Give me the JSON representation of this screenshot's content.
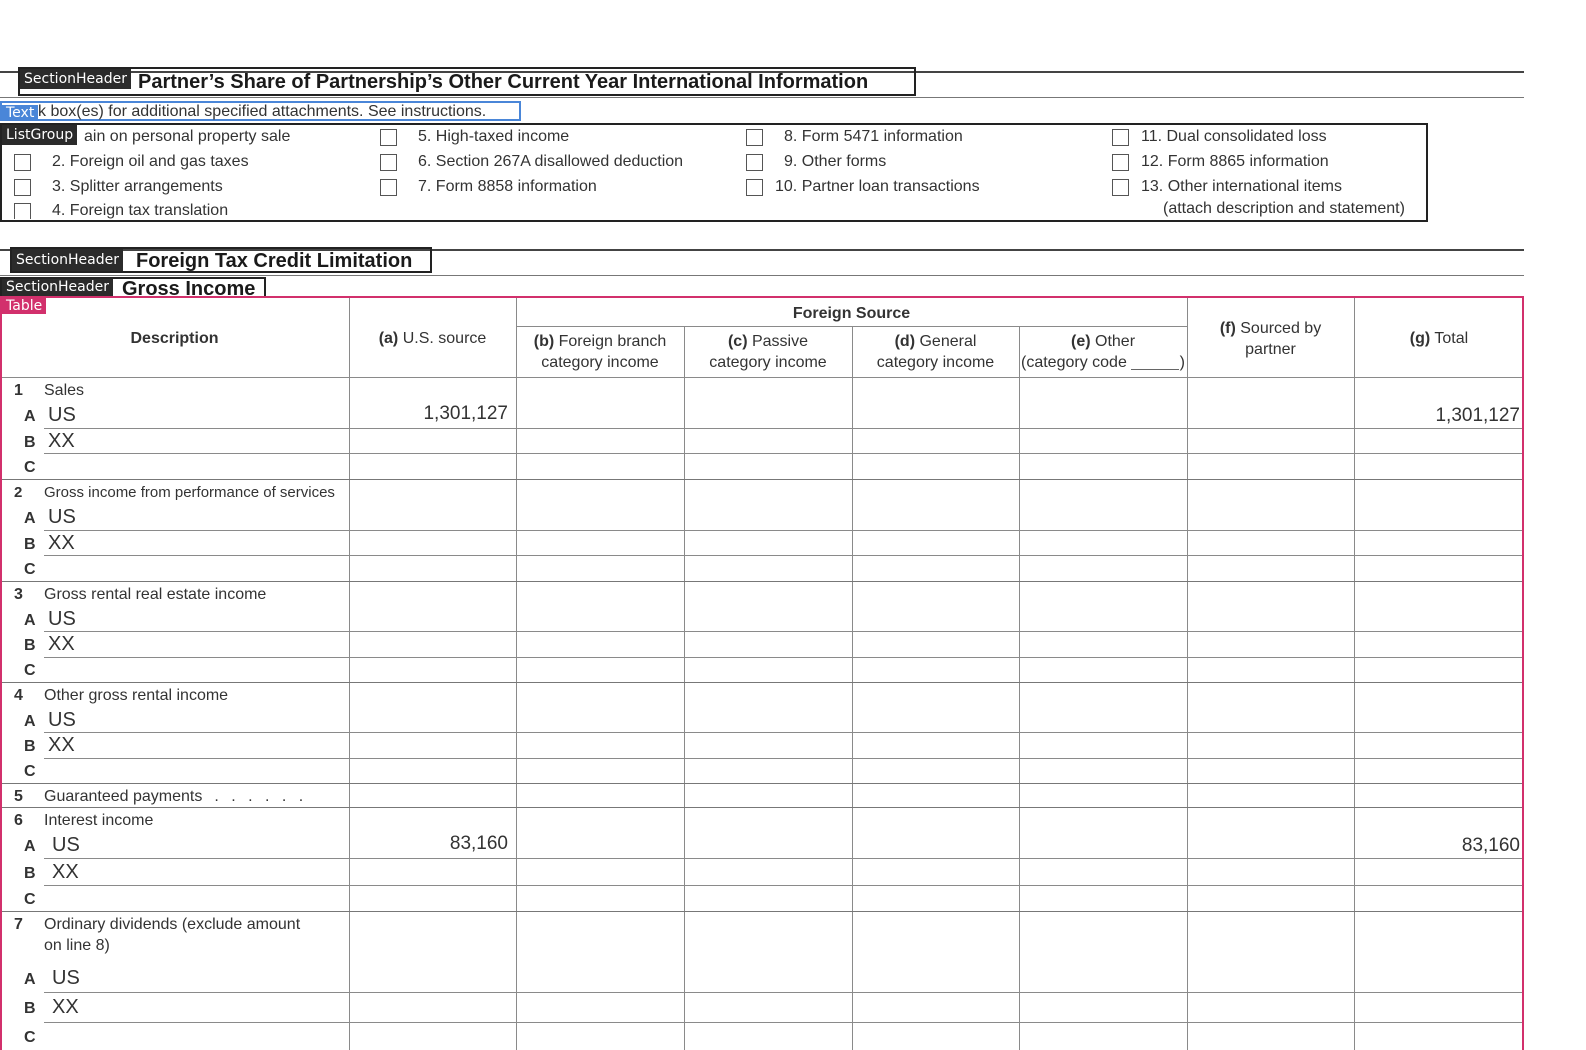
{
  "annotations": {
    "section_header": "SectionHeader",
    "text": "Text",
    "list_group": "ListGroup",
    "table": "Table"
  },
  "part_header": {
    "title": "Partner’s Share of Partnership’s Other Current Year International Information"
  },
  "instructions": "k box(es) for additional specified attachments. See instructions.",
  "checkboxes": {
    "col1": [
      "ain on personal property sale",
      "2. Foreign oil and gas taxes",
      "3. Splitter arrangements",
      "4. Foreign tax translation"
    ],
    "col2": [
      "5. High-taxed income",
      "6. Section 267A disallowed deduction",
      "7. Form 8858 information"
    ],
    "col3": [
      "8. Form 5471 information",
      "9. Other forms",
      "10. Partner loan transactions"
    ],
    "col4": [
      "11. Dual consolidated loss",
      "12. Form 8865 information",
      "13. Other international items"
    ],
    "col4_note": "(attach description and statement)"
  },
  "section2": {
    "title": "Foreign Tax Credit Limitation"
  },
  "section3": {
    "title": "Gross Income"
  },
  "table": {
    "headers": {
      "description": "Description",
      "a_letter": "(a)",
      "a_text": "U.S. source",
      "foreign_source": "Foreign Source",
      "b_letter": "(b)",
      "b_text1": "Foreign branch",
      "b_text2": "category income",
      "c_letter": "(c)",
      "c_text1": "Passive",
      "c_text2": "category income",
      "d_letter": "(d)",
      "d_text1": "General",
      "d_text2": "category income",
      "e_letter": "(e)",
      "e_text1": "Other",
      "e_text2": "(category code",
      "e_text3": ")",
      "f_letter": "(f)",
      "f_text1": "Sourced by",
      "f_text2": "partner",
      "g_letter": "(g)",
      "g_text": "Total"
    },
    "lines": [
      {
        "num": "1",
        "label": "Sales",
        "rows": [
          {
            "letter": "A",
            "name": "US",
            "a": "1,301,127",
            "g": "1,301,127"
          },
          {
            "letter": "B",
            "name": "XX",
            "a": "",
            "g": ""
          },
          {
            "letter": "C",
            "name": "",
            "a": "",
            "g": ""
          }
        ]
      },
      {
        "num": "2",
        "label": "Gross income from performance of services",
        "rows": [
          {
            "letter": "A",
            "name": "US",
            "a": "",
            "g": ""
          },
          {
            "letter": "B",
            "name": "XX",
            "a": "",
            "g": ""
          },
          {
            "letter": "C",
            "name": "",
            "a": "",
            "g": ""
          }
        ]
      },
      {
        "num": "3",
        "label": "Gross rental real estate income",
        "rows": [
          {
            "letter": "A",
            "name": "US",
            "a": "",
            "g": ""
          },
          {
            "letter": "B",
            "name": "XX",
            "a": "",
            "g": ""
          },
          {
            "letter": "C",
            "name": "",
            "a": "",
            "g": ""
          }
        ]
      },
      {
        "num": "4",
        "label": "Other gross rental income",
        "rows": [
          {
            "letter": "A",
            "name": "US",
            "a": "",
            "g": ""
          },
          {
            "letter": "B",
            "name": "XX",
            "a": "",
            "g": ""
          },
          {
            "letter": "C",
            "name": "",
            "a": "",
            "g": ""
          }
        ]
      },
      {
        "num": "5",
        "label": "Guaranteed payments",
        "dots": ". . . . . .",
        "rows": []
      },
      {
        "num": "6",
        "label": "Interest income",
        "rows": [
          {
            "letter": "A",
            "name": "US",
            "a": "83,160",
            "g": "83,160"
          },
          {
            "letter": "B",
            "name": "XX",
            "a": "",
            "g": ""
          },
          {
            "letter": "C",
            "name": "",
            "a": "",
            "g": ""
          }
        ]
      },
      {
        "num": "7",
        "label": "Ordinary dividends (exclude amount",
        "label2": "on line 8)",
        "rows": [
          {
            "letter": "A",
            "name": "US",
            "a": "",
            "g": ""
          },
          {
            "letter": "B",
            "name": "XX",
            "a": "",
            "g": ""
          },
          {
            "letter": "C",
            "name": "",
            "a": "",
            "g": ""
          }
        ]
      }
    ]
  }
}
